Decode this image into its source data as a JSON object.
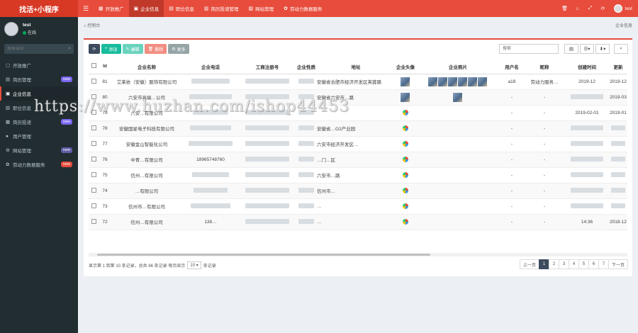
{
  "app": {
    "brand": "找活+小程序"
  },
  "topnav": [
    {
      "label": "开放推广",
      "icon": "▦",
      "active": false
    },
    {
      "label": "企业信息",
      "icon": "▣",
      "active": true
    },
    {
      "label": "职位信息",
      "icon": "▤",
      "active": false
    },
    {
      "label": "简历投递管理",
      "icon": "▥",
      "active": false
    },
    {
      "label": "网站管理",
      "icon": "▧",
      "active": false
    },
    {
      "label": "劳动力数据服务",
      "icon": "✿",
      "active": false
    }
  ],
  "user": {
    "name": "test",
    "status": "在线"
  },
  "sidebar": {
    "search_placeholder": "搜索菜单",
    "items": [
      {
        "label": "开放推广",
        "icon": "▢",
        "badge": "",
        "badge_color": ""
      },
      {
        "label": "简历管理",
        "icon": "▤",
        "badge": "new",
        "badge_color": "#7b68ee"
      },
      {
        "label": "企业信息",
        "icon": "▣",
        "badge": "",
        "badge_color": ""
      },
      {
        "label": "职位信息",
        "icon": "▥",
        "badge": "",
        "badge_color": ""
      },
      {
        "label": "简历投递",
        "icon": "▦",
        "badge": "new",
        "badge_color": "#7b68ee"
      },
      {
        "label": "用户管理",
        "icon": "●",
        "badge": "",
        "badge_color": ""
      },
      {
        "label": "网站管理",
        "icon": "⚙",
        "badge": "new",
        "badge_color": "#605ca8"
      },
      {
        "label": "劳动力数据服务",
        "icon": "✿",
        "badge": "new",
        "badge_color": "#e74c3c"
      }
    ]
  },
  "content": {
    "breadcrumb_left": "控制台",
    "breadcrumb_right": "企业信息"
  },
  "toolbar": {
    "add": "添加",
    "edit": "编辑",
    "delete": "删除",
    "more": "更多"
  },
  "search": {
    "placeholder": "搜索"
  },
  "table": {
    "headers": [
      "",
      "Id",
      "企业名称",
      "企业电话",
      "工商注册号",
      "企业性质",
      "地址",
      "企业头像",
      "企业照片",
      "用户名",
      "昵称",
      "创建时间",
      "更新"
    ],
    "rows": [
      {
        "id": "81",
        "name": "艾莱依（安徽）服饰有限公司",
        "phone": "",
        "addr": "安徽省合肥市经济开发区芙蓉路",
        "user": "a18",
        "nick": "劳动力服务…",
        "created": "2019-12",
        "updated": "2019-12",
        "imgs": 6,
        "icon": "thumb"
      },
      {
        "id": "80",
        "name": "六安市高端…公司",
        "phone": "",
        "addr": "安徽省六安市…路",
        "user": "-",
        "nick": "-",
        "created": "",
        "updated": "2019-03",
        "imgs": 1,
        "icon": "thumb"
      },
      {
        "id": "79",
        "name": "六安…有限公司",
        "phone": "",
        "addr": "",
        "user": "-",
        "nick": "-",
        "created": "2019-02-01",
        "updated": "2019-01",
        "imgs": 0,
        "icon": "dot"
      },
      {
        "id": "78",
        "name": "安徽国星电子科技有限公司",
        "phone": "",
        "addr": "安徽省…G2产业园",
        "user": "-",
        "nick": "-",
        "created": "",
        "updated": "",
        "imgs": 0,
        "icon": "dot"
      },
      {
        "id": "77",
        "name": "安徽金山智能化公司",
        "phone": "",
        "addr": "六安市经济开发区…",
        "user": "-",
        "nick": "-",
        "created": "",
        "updated": "",
        "imgs": 0,
        "icon": "dot"
      },
      {
        "id": "76",
        "name": "中青…有限公司",
        "phone": "18965748760",
        "addr": "…门…区",
        "user": "-",
        "nick": "-",
        "created": "",
        "updated": "",
        "imgs": 0,
        "icon": "dot"
      },
      {
        "id": "75",
        "name": "信州…有限公司",
        "phone": "",
        "addr": "六安市…路",
        "user": "-",
        "nick": "-",
        "created": "",
        "updated": "",
        "imgs": 0,
        "icon": "dot"
      },
      {
        "id": "74",
        "name": "…有限公司",
        "phone": "",
        "addr": "信州市…",
        "user": "-",
        "nick": "-",
        "created": "",
        "updated": "",
        "imgs": 0,
        "icon": "dot"
      },
      {
        "id": "73",
        "name": "信州市…有限公司",
        "phone": "",
        "addr": "…",
        "user": "-",
        "nick": "-",
        "created": "",
        "updated": "",
        "imgs": 0,
        "icon": "dot"
      },
      {
        "id": "72",
        "name": "信州…有限公司",
        "phone": "138…",
        "addr": "…",
        "user": "-",
        "nick": "-",
        "created": "14:36",
        "updated": "2018-12",
        "imgs": 0,
        "icon": "dot"
      }
    ]
  },
  "pagination": {
    "info_prefix": "显示第 1 到第 10 条记录，总共 66 条记录 每页显示",
    "page_size": "10",
    "info_suffix": "条记录",
    "prev": "上一页",
    "pages": [
      "1",
      "2",
      "3",
      "4",
      "5",
      "6",
      "7"
    ],
    "next": "下一页",
    "current": "1"
  },
  "watermark": "https://www.huzhan.com/ishop44453"
}
